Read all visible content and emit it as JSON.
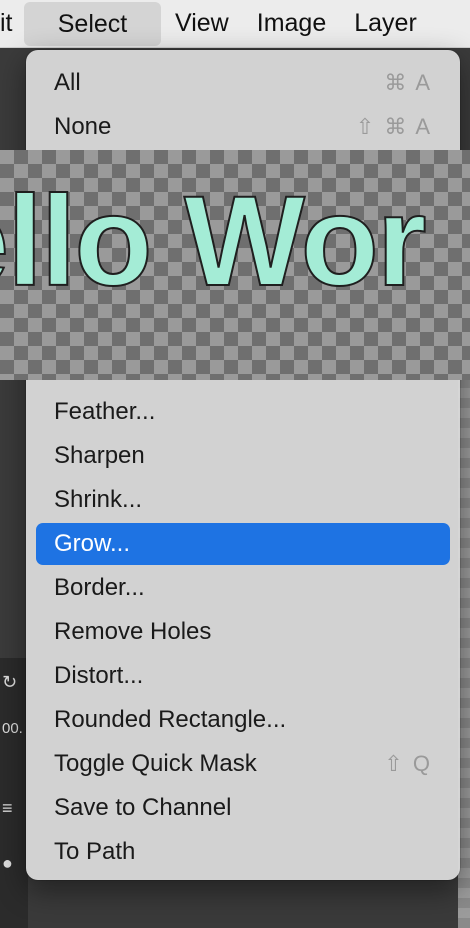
{
  "menubar": {
    "items": [
      {
        "label": "it"
      },
      {
        "label": "Select"
      },
      {
        "label": "View"
      },
      {
        "label": "Image"
      },
      {
        "label": "Layer"
      }
    ]
  },
  "canvas": {
    "text": "ello Wor",
    "text_color": "#a4ecd6"
  },
  "menu": {
    "top_items": [
      {
        "label": "All",
        "shortcut": "⌘ A"
      },
      {
        "label": "None",
        "shortcut": "⇧ ⌘ A"
      }
    ],
    "items": [
      {
        "label": "Feather...",
        "shortcut": ""
      },
      {
        "label": "Sharpen",
        "shortcut": ""
      },
      {
        "label": "Shrink...",
        "shortcut": ""
      },
      {
        "label": "Grow...",
        "shortcut": ""
      },
      {
        "label": "Border...",
        "shortcut": ""
      },
      {
        "label": "Remove Holes",
        "shortcut": ""
      },
      {
        "label": "Distort...",
        "shortcut": ""
      },
      {
        "label": "Rounded Rectangle...",
        "shortcut": ""
      },
      {
        "label": "Toggle Quick Mask",
        "shortcut": "⇧ Q"
      },
      {
        "label": "Save to Channel",
        "shortcut": ""
      },
      {
        "label": "To Path",
        "shortcut": ""
      }
    ],
    "highlight_color": "#1e73e3"
  },
  "background": {
    "zoom_text": "00."
  }
}
